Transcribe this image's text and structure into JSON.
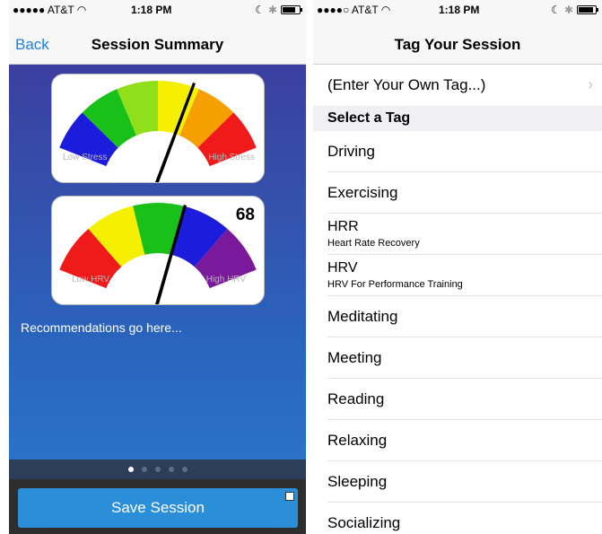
{
  "left": {
    "status": {
      "carrier": "●●●●● AT&T",
      "time": "1:18 PM",
      "battery_level": 0.75
    },
    "nav": {
      "back": "Back",
      "title": "Session Summary"
    },
    "stress_gauge": {
      "low_label": "Low Stress",
      "high_label": "High Stress"
    },
    "hrv_gauge": {
      "low_label": "Low HRV",
      "high_label": "High HRV",
      "value": "68"
    },
    "recommendations": "Recommendations go here...",
    "pages": {
      "count": 5,
      "active": 0
    },
    "save_label": "Save Session"
  },
  "right": {
    "status": {
      "carrier": "●●●●○ AT&T",
      "time": "1:18 PM",
      "battery_level": 0.9
    },
    "title": "Tag Your Session",
    "enter_own": "(Enter Your Own Tag...)",
    "section_header": "Select a Tag",
    "tags": [
      {
        "label": "Driving"
      },
      {
        "label": "Exercising"
      },
      {
        "label": "HRR",
        "sub": "Heart Rate Recovery"
      },
      {
        "label": "HRV",
        "sub": "HRV For Performance Training"
      },
      {
        "label": "Meditating"
      },
      {
        "label": "Meeting"
      },
      {
        "label": "Reading"
      },
      {
        "label": "Relaxing"
      },
      {
        "label": "Sleeping"
      },
      {
        "label": "Socializing"
      }
    ]
  },
  "colors": {
    "accent": "#2a8ed9",
    "link": "#1a7fe6",
    "gauge_stress": [
      "#1c1cdc",
      "#18c018",
      "#8fe01a",
      "#f5f000",
      "#f5a000",
      "#f01a1a"
    ],
    "gauge_hrv": [
      "#ef1a1a",
      "#f5f000",
      "#18c018",
      "#1c1cdc",
      "#7a1a9a"
    ]
  }
}
